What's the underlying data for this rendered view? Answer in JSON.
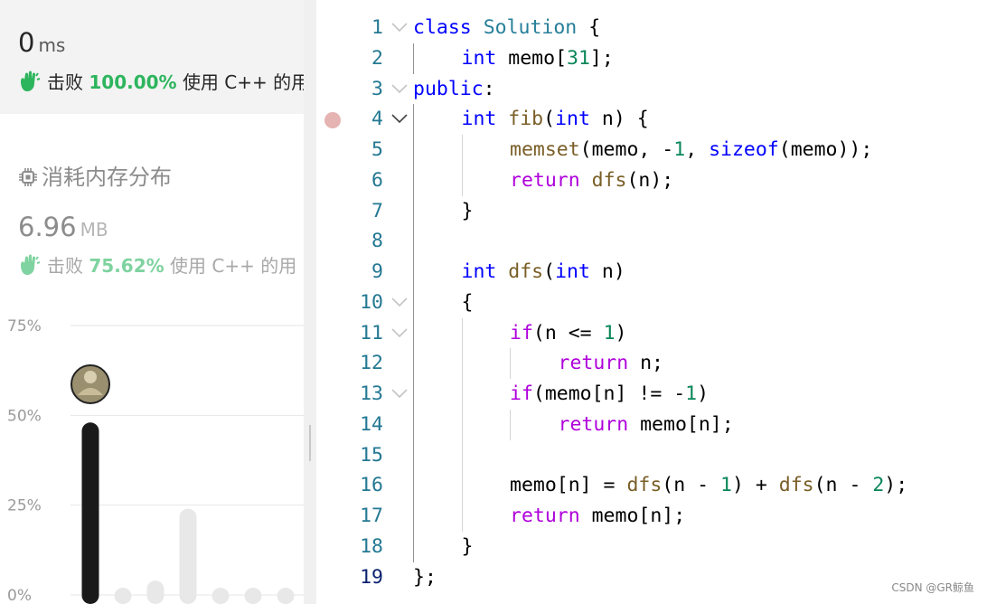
{
  "runtime": {
    "value": "0",
    "unit": "ms",
    "beats_prefix": "击败",
    "beats_percent": "100.00%",
    "beats_suffix": "使用 C++ 的用",
    "accent": "#2db55d"
  },
  "memory": {
    "title": "消耗内存分布",
    "value": "6.96",
    "unit": "MB",
    "beats_prefix": "击败",
    "beats_percent": "75.62%",
    "beats_suffix": "使用 C++ 的用",
    "accent": "#7fd3a0"
  },
  "chart_data": {
    "type": "bar",
    "y_ticks": [
      "75%",
      "50%",
      "25%",
      "0%"
    ],
    "ylim": [
      0,
      75
    ],
    "values": [
      48,
      2,
      4,
      24,
      2,
      2,
      2
    ],
    "highlight_index": 0,
    "colors": {
      "highlight": "#1a1a1a",
      "other": "#e8e8e8"
    },
    "title": "",
    "xlabel": "",
    "ylabel": ""
  },
  "editor": {
    "lines": [
      {
        "n": "1",
        "fold": true,
        "depth": 0,
        "tokens": [
          [
            "kw",
            "class"
          ],
          [
            "",
            " "
          ],
          [
            "ty",
            "Solution"
          ],
          [
            "",
            " {"
          ]
        ]
      },
      {
        "n": "2",
        "fold": false,
        "depth": 1,
        "tokens": [
          [
            "kw",
            "int"
          ],
          [
            "",
            " memo["
          ],
          [
            "num",
            "31"
          ],
          [
            "",
            "];"
          ]
        ]
      },
      {
        "n": "3",
        "fold": true,
        "depth": 0,
        "tokens": [
          [
            "kw",
            "public"
          ],
          [
            "",
            ":"
          ]
        ]
      },
      {
        "n": "4",
        "fold": true,
        "depth": 1,
        "tokens": [
          [
            "kw",
            "int"
          ],
          [
            "",
            " "
          ],
          [
            "fn",
            "fib"
          ],
          [
            "",
            "("
          ],
          [
            "kw",
            "int"
          ],
          [
            "",
            " n) {"
          ]
        ]
      },
      {
        "n": "5",
        "fold": false,
        "depth": 2,
        "tokens": [
          [
            "fn",
            "memset"
          ],
          [
            "",
            "(memo, -"
          ],
          [
            "num",
            "1"
          ],
          [
            "",
            ", "
          ],
          [
            "kw",
            "sizeof"
          ],
          [
            "",
            "(memo));"
          ]
        ]
      },
      {
        "n": "6",
        "fold": false,
        "depth": 2,
        "tokens": [
          [
            "ctl",
            "return"
          ],
          [
            "",
            " "
          ],
          [
            "fn",
            "dfs"
          ],
          [
            "",
            "(n);"
          ]
        ]
      },
      {
        "n": "7",
        "fold": false,
        "depth": 1,
        "tokens": [
          [
            "",
            "}"
          ]
        ]
      },
      {
        "n": "8",
        "fold": false,
        "depth": 0,
        "tokens": []
      },
      {
        "n": "9",
        "fold": false,
        "depth": 1,
        "tokens": [
          [
            "kw",
            "int"
          ],
          [
            "",
            " "
          ],
          [
            "fn",
            "dfs"
          ],
          [
            "",
            "("
          ],
          [
            "kw",
            "int"
          ],
          [
            "",
            " n)"
          ]
        ]
      },
      {
        "n": "10",
        "fold": true,
        "depth": 1,
        "tokens": [
          [
            "",
            "{"
          ]
        ]
      },
      {
        "n": "11",
        "fold": true,
        "depth": 2,
        "tokens": [
          [
            "ctl",
            "if"
          ],
          [
            "",
            "(n <= "
          ],
          [
            "num",
            "1"
          ],
          [
            "",
            ")"
          ]
        ]
      },
      {
        "n": "12",
        "fold": false,
        "depth": 3,
        "tokens": [
          [
            "ctl",
            "return"
          ],
          [
            "",
            " n;"
          ]
        ]
      },
      {
        "n": "13",
        "fold": true,
        "depth": 2,
        "tokens": [
          [
            "ctl",
            "if"
          ],
          [
            "",
            "(memo[n] != -"
          ],
          [
            "num",
            "1"
          ],
          [
            "",
            ")"
          ]
        ]
      },
      {
        "n": "14",
        "fold": false,
        "depth": 3,
        "tokens": [
          [
            "ctl",
            "return"
          ],
          [
            "",
            " memo[n];"
          ]
        ]
      },
      {
        "n": "15",
        "fold": false,
        "depth": 0,
        "tokens": []
      },
      {
        "n": "16",
        "fold": false,
        "depth": 2,
        "tokens": [
          [
            "",
            "memo[n] = "
          ],
          [
            "fn",
            "dfs"
          ],
          [
            "",
            "(n - "
          ],
          [
            "num",
            "1"
          ],
          [
            "",
            ") + "
          ],
          [
            "fn",
            "dfs"
          ],
          [
            "",
            "(n - "
          ],
          [
            "num",
            "2"
          ],
          [
            "",
            ");"
          ]
        ]
      },
      {
        "n": "17",
        "fold": false,
        "depth": 2,
        "tokens": [
          [
            "ctl",
            "return"
          ],
          [
            "",
            " memo[n];"
          ]
        ]
      },
      {
        "n": "18",
        "fold": false,
        "depth": 1,
        "tokens": [
          [
            "",
            "}"
          ]
        ]
      },
      {
        "n": "19",
        "fold": false,
        "depth": 0,
        "tokens": [
          [
            "",
            "};"
          ]
        ]
      }
    ],
    "current_line": "19",
    "breakpoint_line": "4"
  },
  "watermark": "CSDN @GR鲸鱼"
}
